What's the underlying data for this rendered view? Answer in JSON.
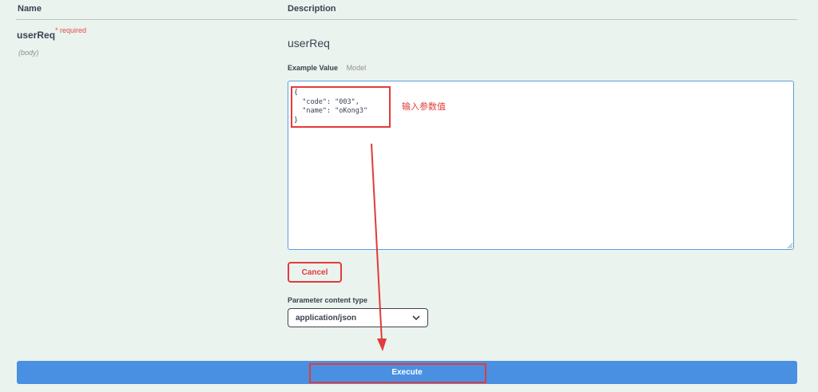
{
  "table": {
    "col_name": "Name",
    "col_description": "Description"
  },
  "param": {
    "name": "userReq",
    "required": "* required",
    "in": "(body)",
    "title": "userReq",
    "tab_example": "Example Value",
    "tab_model": "Model",
    "body_value": "{\n  \"code\": \"003\",\n  \"name\": \"oKong3\"\n}"
  },
  "annotation": {
    "text": "输入参数值",
    "color": "#e23b3b"
  },
  "buttons": {
    "cancel": "Cancel",
    "execute": "Execute"
  },
  "content_type": {
    "label": "Parameter content type",
    "selected": "application/json"
  },
  "icons": {
    "dropdown": "chevron-down-icon",
    "resize": "resize-grip-icon",
    "arrow": "annotation-arrow"
  },
  "colors": {
    "execute": "#4990e2",
    "required": "#e34b4b",
    "highlight": "#e23b3b"
  }
}
